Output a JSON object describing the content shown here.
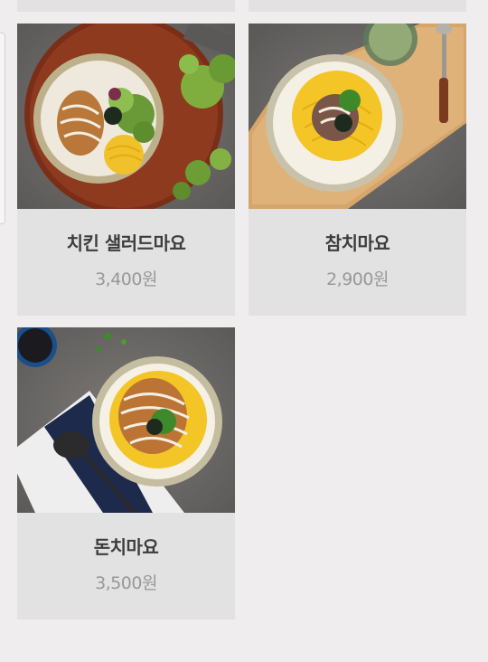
{
  "menu": {
    "items": [
      {
        "name": "치킨 샐러드마요",
        "price": "3,400원",
        "photo_icon": "chicken-salad-mayo-bowl-photo"
      },
      {
        "name": "참치마요",
        "price": "2,900원",
        "photo_icon": "tuna-mayo-bowl-photo"
      },
      {
        "name": "돈치마요",
        "price": "3,500원",
        "photo_icon": "pork-cutlet-mayo-bowl-photo"
      }
    ]
  },
  "colors": {
    "page_bg": "#efedee",
    "card_bg": "#e3e2e3",
    "name_text": "#3d3d3d",
    "price_text": "#999797"
  }
}
